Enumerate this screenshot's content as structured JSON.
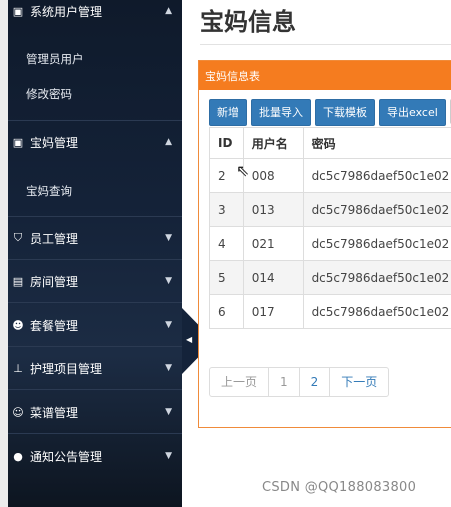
{
  "sidebar": {
    "groups": [
      {
        "label": "系统用户管理",
        "icon": "id-card-icon",
        "expanded": true,
        "items": [
          "管理员用户",
          "修改密码"
        ]
      },
      {
        "label": "宝妈管理",
        "icon": "id-card-icon",
        "expanded": true,
        "items": [
          "宝妈查询"
        ]
      },
      {
        "label": "员工管理",
        "icon": "shield-icon",
        "expanded": false,
        "items": []
      },
      {
        "label": "房间管理",
        "icon": "document-icon",
        "expanded": false,
        "items": []
      },
      {
        "label": "套餐管理",
        "icon": "users-icon",
        "expanded": false,
        "items": []
      },
      {
        "label": "护理项目管理",
        "icon": "sitemap-icon",
        "expanded": false,
        "items": []
      },
      {
        "label": "菜谱管理",
        "icon": "user-plus-icon",
        "expanded": false,
        "items": []
      },
      {
        "label": "通知公告管理",
        "icon": "user-icon",
        "expanded": false,
        "items": []
      }
    ]
  },
  "main": {
    "title": "宝妈信息",
    "panel_title": "宝妈信息表",
    "toolbar": {
      "add": "新增",
      "batch_import": "批量导入",
      "download_template": "下载模板",
      "export_excel": "导出excel"
    },
    "table": {
      "headers": [
        "ID",
        "用户名",
        "密码"
      ],
      "rows": [
        [
          "2",
          "008",
          "dc5c7986daef50c1e02"
        ],
        [
          "3",
          "013",
          "dc5c7986daef50c1e02"
        ],
        [
          "4",
          "021",
          "dc5c7986daef50c1e02"
        ],
        [
          "5",
          "014",
          "dc5c7986daef50c1e02"
        ],
        [
          "6",
          "017",
          "dc5c7986daef50c1e02"
        ]
      ]
    },
    "pager": {
      "prev": "上一页",
      "pages": [
        "1",
        "2"
      ],
      "next": "下一页"
    }
  },
  "watermark": "CSDN @QQ188083800",
  "colors": {
    "accent_orange": "#f57c1f",
    "button_blue": "#337ab7",
    "sidebar_dark": "#142238"
  }
}
